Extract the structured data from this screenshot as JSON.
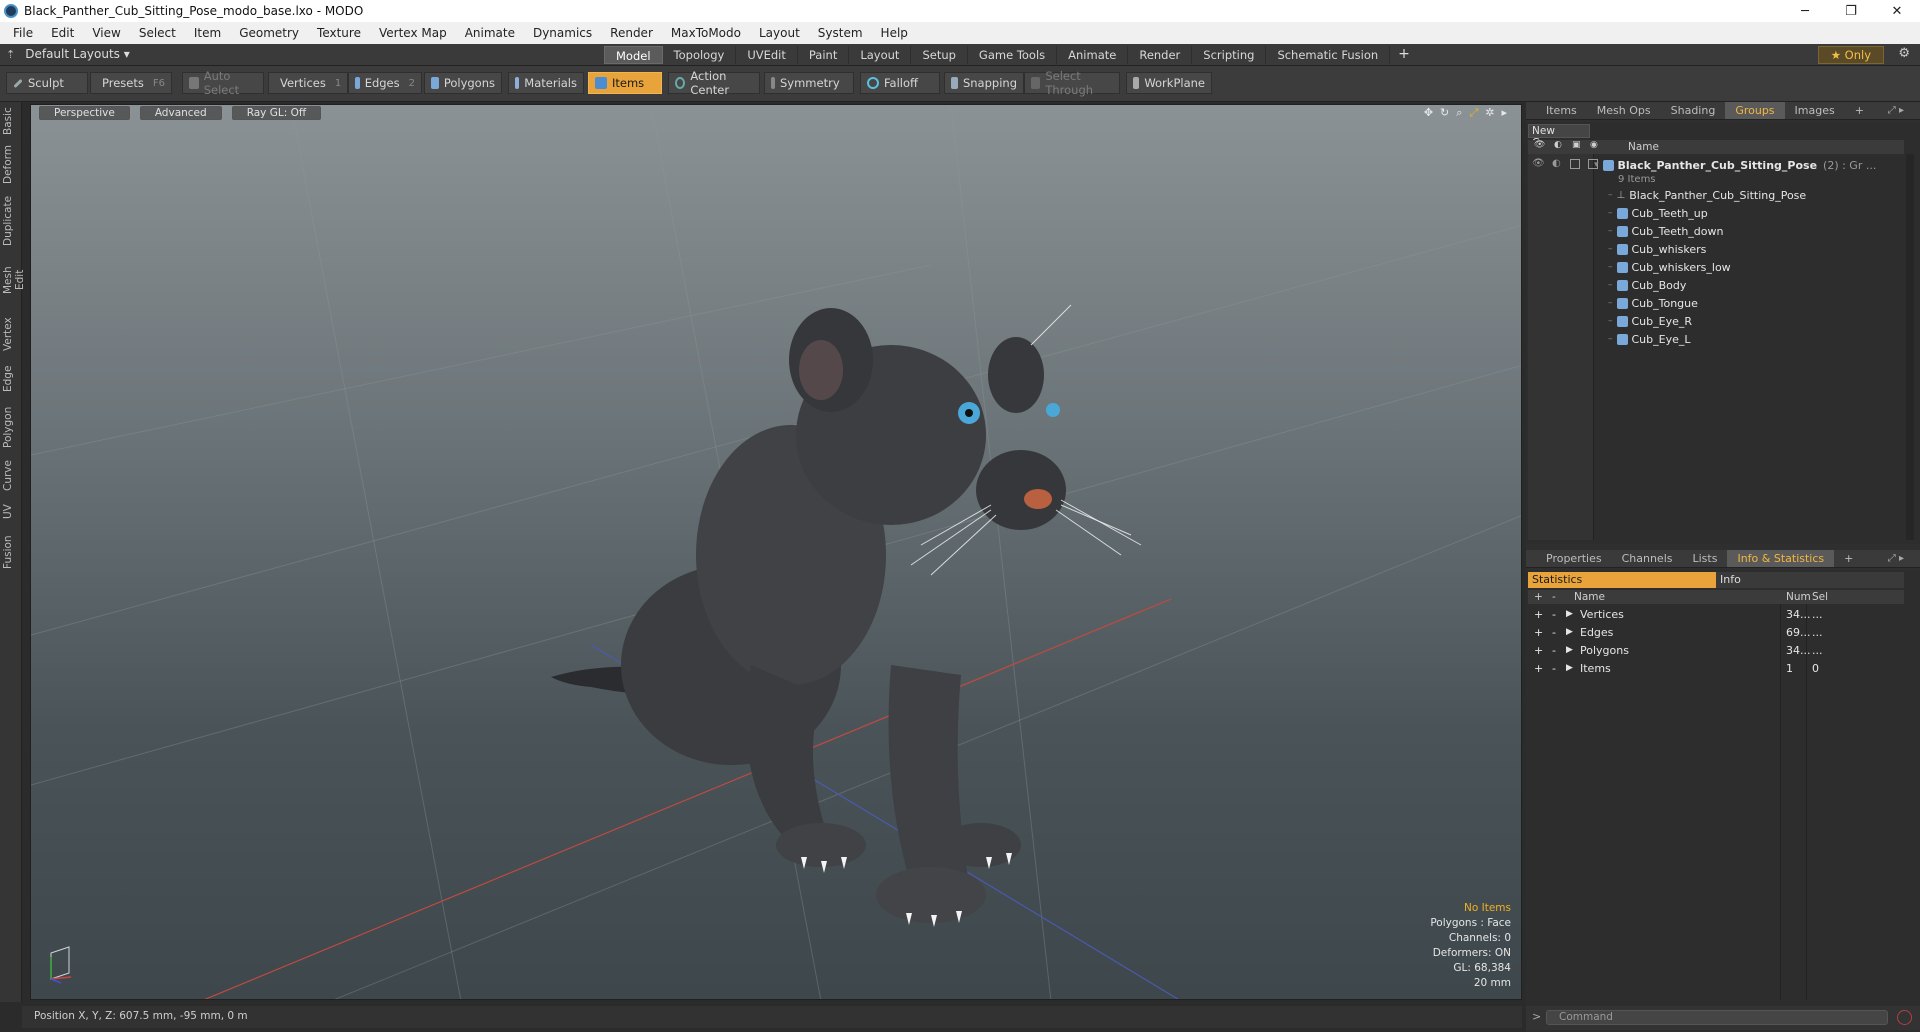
{
  "window": {
    "title": "Black_Panther_Cub_Sitting_Pose_modo_base.lxo - MODO",
    "minimize": "─",
    "maximize": "❐",
    "close": "✕"
  },
  "menu": [
    "File",
    "Edit",
    "View",
    "Select",
    "Item",
    "Geometry",
    "Texture",
    "Vertex Map",
    "Animate",
    "Dynamics",
    "Render",
    "MaxToModo",
    "Layout",
    "System",
    "Help"
  ],
  "layoutbar": {
    "layouts_label": "Default Layouts ▾",
    "tabs": [
      "Model",
      "Topology",
      "UVEdit",
      "Paint",
      "Layout",
      "Setup",
      "Game Tools",
      "Animate",
      "Render",
      "Scripting",
      "Schematic Fusion"
    ],
    "active_tab": "Model",
    "plus": "+",
    "only_label": "★  Only",
    "gear": "⚙"
  },
  "toolbar": {
    "sculpt": "Sculpt",
    "presets": "Presets",
    "presets_key": "F6",
    "auto_select": "Auto Select",
    "vertices": "Vertices",
    "vertices_num": "1",
    "edges": "Edges",
    "edges_num": "2",
    "polygons": "Polygons",
    "materials": "Materials",
    "items": "Items",
    "action_center": "Action Center",
    "symmetry": "Symmetry",
    "falloff": "Falloff",
    "snapping": "Snapping",
    "select_through": "Select Through",
    "workplane": "WorkPlane"
  },
  "leftstrip": [
    "Basic",
    "Deform",
    "Duplicate",
    "Mesh Edit",
    "Vertex",
    "Edge",
    "Polygon",
    "Curve",
    "UV",
    "Fusion"
  ],
  "viewport": {
    "view_mode": "Perspective",
    "shading": "Advanced",
    "raygl": "Ray GL: Off",
    "stats": {
      "selection": "No Items",
      "polygons": "Polygons : Face",
      "channels": "Channels: 0",
      "deformers": "Deformers: ON",
      "gl": "GL: 68,384",
      "scale": "20 mm"
    }
  },
  "statusbar": {
    "position": "Position X, Y, Z:   607.5 mm, -95 mm, 0 m"
  },
  "panel_top": {
    "tabs": [
      "Items",
      "Mesh Ops",
      "Shading",
      "Groups",
      "Images"
    ],
    "active_tab": "Groups",
    "plus": "+",
    "new_group": "New Group",
    "name_header": "Name",
    "group": {
      "name": "Black_Panther_Cub_Sitting_Pose",
      "suffix": "(2) : Gr ...",
      "count": "9 Items"
    },
    "items": [
      "Black_Panther_Cub_Sitting_Pose",
      "Cub_Teeth_up",
      "Cub_Teeth_down",
      "Cub_whiskers",
      "Cub_whiskers_low",
      "Cub_Body",
      "Cub_Tongue",
      "Cub_Eye_R",
      "Cub_Eye_L"
    ]
  },
  "panel_bottom": {
    "tabs": [
      "Properties",
      "Channels",
      "Lists",
      "Info & Statistics"
    ],
    "active_tab": "Info & Statistics",
    "plus": "+",
    "subtabs": [
      "Statistics",
      "Info"
    ],
    "headers": {
      "name": "Name",
      "num": "Num",
      "sel": "Sel"
    },
    "rows": [
      {
        "name": "Vertices",
        "num": "34...",
        "sel": "..."
      },
      {
        "name": "Edges",
        "num": "69...",
        "sel": "..."
      },
      {
        "name": "Polygons",
        "num": "34...",
        "sel": "..."
      },
      {
        "name": "Items",
        "num": "1",
        "sel": "0"
      }
    ]
  },
  "command": {
    "placeholder": "Command",
    "prompt": ">"
  },
  "colors": {
    "accent": "#e8a33a",
    "viewport_top": "#8b9296",
    "viewport_bottom": "#3e474b"
  }
}
